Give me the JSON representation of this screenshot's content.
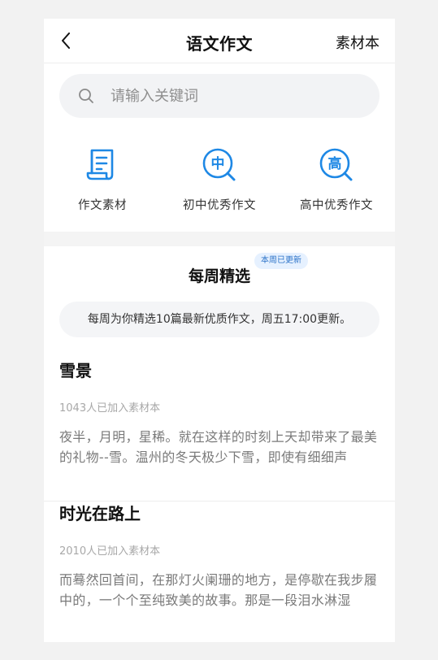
{
  "header": {
    "title": "语文作文",
    "action_label": "素材本"
  },
  "search": {
    "placeholder": "请输入关键词"
  },
  "categories": [
    {
      "label": "作文素材",
      "icon": "document-icon"
    },
    {
      "label": "初中优秀作文",
      "icon": "zhong-search-icon",
      "glyph": "中"
    },
    {
      "label": "高中优秀作文",
      "icon": "gao-search-icon",
      "glyph": "高"
    }
  ],
  "weekly": {
    "title": "每周精选",
    "badge": "本周已更新",
    "note": "每周为你精选10篇最新优质作文，周五17:00更新。"
  },
  "articles": [
    {
      "title": "雪景",
      "count": "1043人已加入素材本",
      "excerpt": "夜半，月明，星稀。就在这样的时刻上天却带来了最美的礼物--雪。温州的冬天极少下雪，即使有细细声"
    },
    {
      "title": "时光在路上",
      "count": "2010人已加入素材本",
      "excerpt": "而蓦然回首间，在那灯火阑珊的地方，是停歇在我步履中的，一个个至纯致美的故事。那是一段泪水淋湿"
    }
  ],
  "colors": {
    "accent": "#1e88e5",
    "badge_bg": "#e6f1ff",
    "badge_text": "#2c73c8"
  }
}
